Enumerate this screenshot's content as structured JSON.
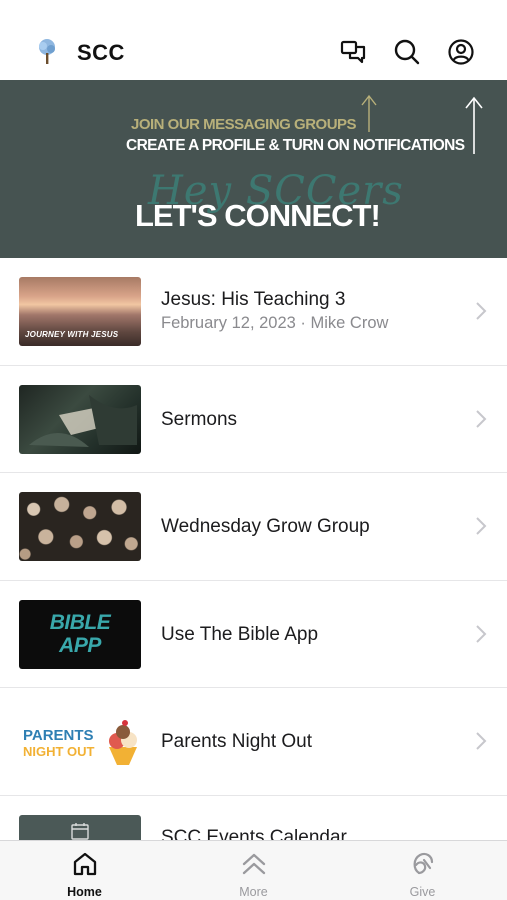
{
  "header": {
    "title": "SCC",
    "icons": [
      "tree-logo-icon",
      "chat-icon",
      "search-icon",
      "account-icon"
    ]
  },
  "banner": {
    "line1": "JOIN OUR MESSAGING GROUPS",
    "line2": "CREATE A PROFILE & TURN ON NOTIFICATIONS",
    "script": "Hey SCCers",
    "headline": "LET'S CONNECT!"
  },
  "list": {
    "items": [
      {
        "title": "Jesus: His Teaching 3",
        "subtitle": "February 12, 2023 · Mike Crow",
        "thumb_caption": "JOURNEY WITH JESUS"
      },
      {
        "title": "Sermons"
      },
      {
        "title": "Wednesday Grow Group"
      },
      {
        "title": "Use The Bible App",
        "thumb_line1": "BIBLE",
        "thumb_line2": "APP"
      },
      {
        "title": "Parents Night Out",
        "thumb_line1": "PARENTS",
        "thumb_line2": "NIGHT OUT"
      },
      {
        "title": "SCC Events Calendar"
      }
    ]
  },
  "tabbar": {
    "tabs": [
      {
        "label": "Home",
        "icon": "home-icon",
        "active": true
      },
      {
        "label": "More",
        "icon": "chevrons-up-icon",
        "active": false
      },
      {
        "label": "Give",
        "icon": "give-icon",
        "active": false
      }
    ]
  },
  "colors": {
    "banner_bg": "#465351",
    "banner_accent": "#b8b07a",
    "text_primary": "#1c1c1e",
    "text_secondary": "#8a8a8e",
    "tab_inactive": "#9a9a9e"
  }
}
